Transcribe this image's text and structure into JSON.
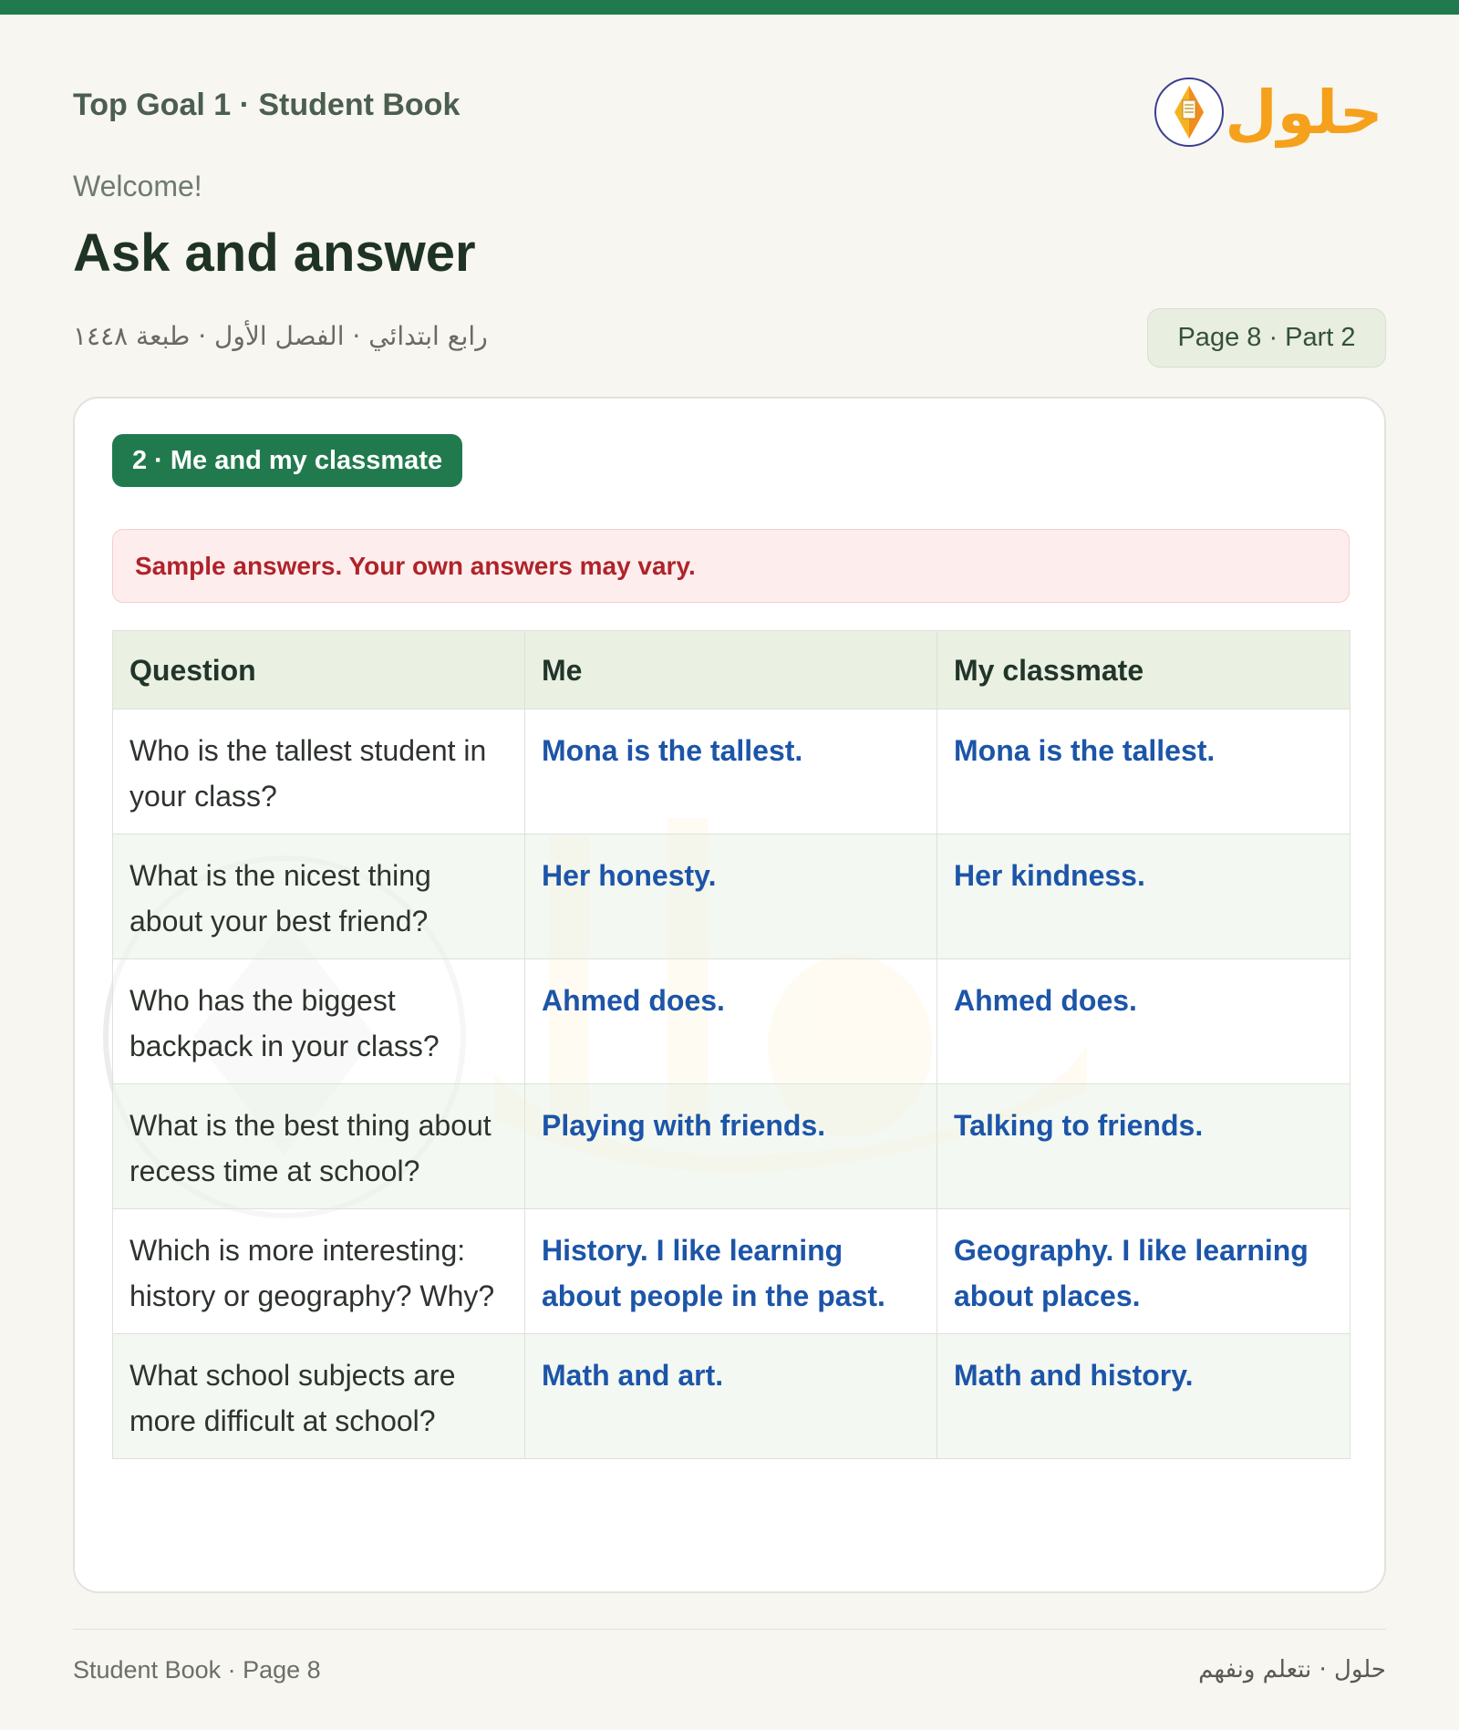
{
  "header": {
    "book_title": "Top Goal 1 · Student Book",
    "logo_text": "حلول",
    "welcome": "Welcome!",
    "page_title": "Ask and answer",
    "meta_ar": "رابع ابتدائي · الفصل الأول · طبعة ١٤٤٨",
    "page_badge": "Page 8 · Part 2"
  },
  "section": {
    "label": "2 · Me and my classmate",
    "note": "Sample answers. Your own answers may vary."
  },
  "table": {
    "headers": [
      "Question",
      "Me",
      "My classmate"
    ],
    "rows": [
      {
        "question": "Who is the tallest student in your class?",
        "me": "Mona is the tallest.",
        "classmate": "Mona is the tallest."
      },
      {
        "question": "What is the nicest thing about your best friend?",
        "me": "Her honesty.",
        "classmate": "Her kindness."
      },
      {
        "question": "Who has the biggest backpack in your class?",
        "me": "Ahmed does.",
        "classmate": "Ahmed does."
      },
      {
        "question": "What is the best thing about recess time at school?",
        "me": "Playing with friends.",
        "classmate": "Talking to friends."
      },
      {
        "question": "Which is more interesting: history or geography? Why?",
        "me": "History. I like learning about people in the past.",
        "classmate": "Geography. I like learning about places."
      },
      {
        "question": "What school subjects are more difficult at school?",
        "me": "Math and art.",
        "classmate": "Math and history."
      }
    ]
  },
  "footer": {
    "left": "Student Book · Page 8",
    "right": "حلول · نتعلم ونفهم"
  },
  "colors": {
    "brand_green": "#217a4e",
    "answer_blue": "#1c55a8",
    "note_red": "#b0232a",
    "logo_orange": "#f5a11c"
  }
}
